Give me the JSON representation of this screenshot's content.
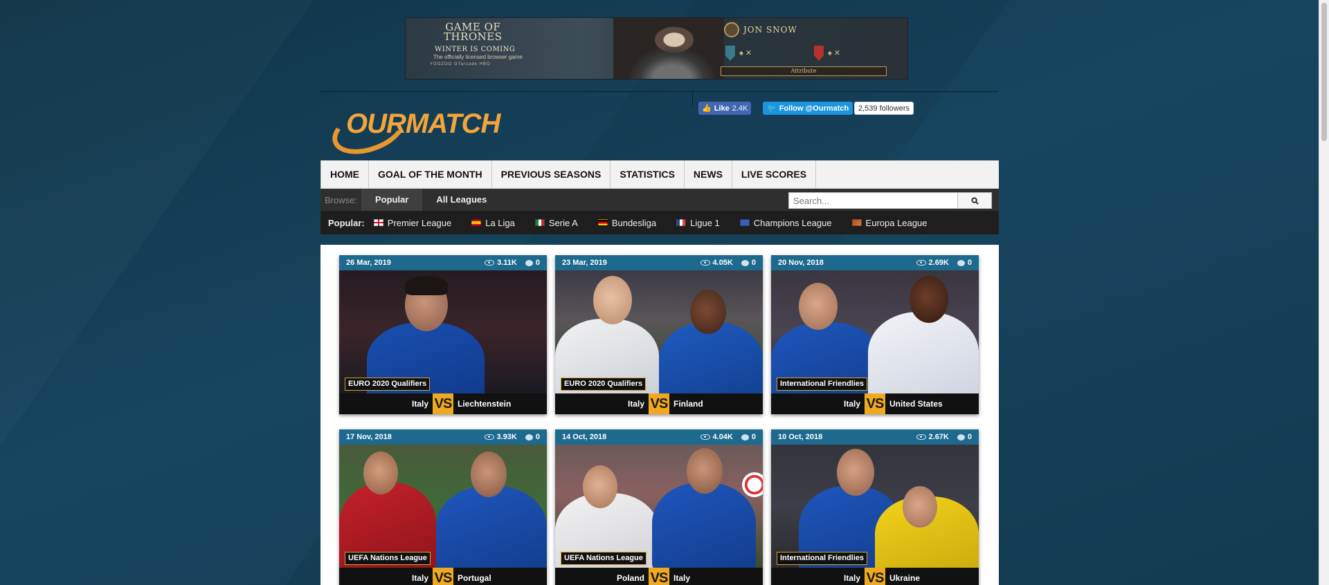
{
  "ad": {
    "title_line1": "GAME OF",
    "title_line2": "THRONES",
    "subtitle": "WINTER IS COMING",
    "tagline": "The officially licensed browser game",
    "brands": "YOOZOO  GTarcade  HBO",
    "character": "JON SNOW",
    "attribute_label": "Attribute"
  },
  "header": {
    "logo_text": "OURMATCH",
    "fb_like_label": "Like",
    "fb_like_count": "2.4K",
    "twitter_follow_label": "Follow @Ourmatch",
    "twitter_followers": "2,539 followers"
  },
  "mainnav": {
    "items": [
      {
        "label": "HOME"
      },
      {
        "label": "GOAL OF THE MONTH"
      },
      {
        "label": "PREVIOUS SEASONS"
      },
      {
        "label": "STATISTICS"
      },
      {
        "label": "NEWS"
      },
      {
        "label": "LIVE SCORES"
      }
    ]
  },
  "subnav": {
    "browse_label": "Browse:",
    "tabs": [
      {
        "label": "Popular",
        "active": true
      },
      {
        "label": "All Leagues",
        "active": false
      }
    ],
    "search_placeholder": "Search..."
  },
  "popular": {
    "label": "Popular:",
    "leagues": [
      {
        "name": "Premier League",
        "flag": "england"
      },
      {
        "name": "La Liga",
        "flag": "spain"
      },
      {
        "name": "Serie A",
        "flag": "italy"
      },
      {
        "name": "Bundesliga",
        "flag": "germany"
      },
      {
        "name": "Ligue 1",
        "flag": "france"
      },
      {
        "name": "Champions League",
        "flag": "europe"
      },
      {
        "name": "Europa League",
        "flag": "europa"
      }
    ]
  },
  "matches": [
    {
      "date": "26 Mar, 2019",
      "views": "3.11K",
      "comments": "0",
      "competition": "EURO 2020 Qualifiers",
      "home": "Italy",
      "away": "Liechtenstein",
      "vs": "VS"
    },
    {
      "date": "23 Mar, 2019",
      "views": "4.05K",
      "comments": "0",
      "competition": "EURO 2020 Qualifiers",
      "home": "Italy",
      "away": "Finland",
      "vs": "VS"
    },
    {
      "date": "20 Nov, 2018",
      "views": "2.69K",
      "comments": "0",
      "competition": "International Friendlies",
      "home": "Italy",
      "away": "United States",
      "vs": "VS"
    },
    {
      "date": "17 Nov, 2018",
      "views": "3.93K",
      "comments": "0",
      "competition": "UEFA Nations League",
      "home": "Italy",
      "away": "Portugal",
      "vs": "VS"
    },
    {
      "date": "14 Oct, 2018",
      "views": "4.04K",
      "comments": "0",
      "competition": "UEFA Nations League",
      "home": "Poland",
      "away": "Italy",
      "vs": "VS"
    },
    {
      "date": "10 Oct, 2018",
      "views": "2.67K",
      "comments": "0",
      "competition": "International Friendlies",
      "home": "Italy",
      "away": "Ukraine",
      "vs": "VS"
    }
  ],
  "colors": {
    "accent": "#f0a81e",
    "card_bar": "#1e6a8e",
    "page_bg": "#133b52"
  }
}
